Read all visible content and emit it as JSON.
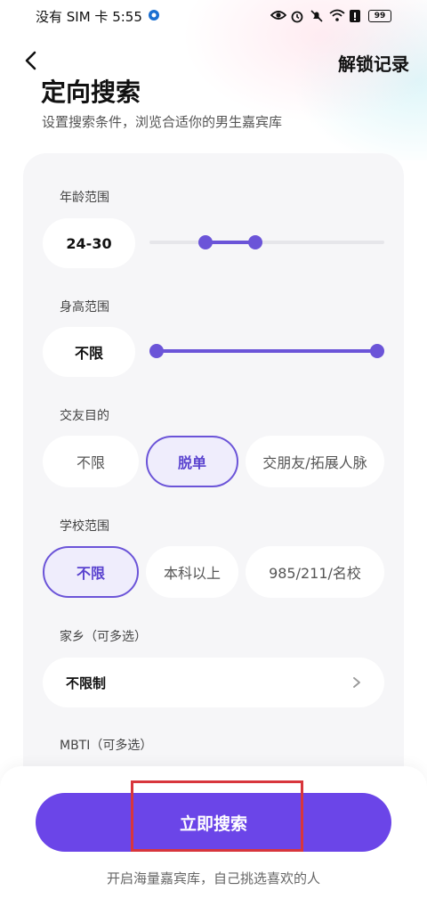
{
  "status_bar": {
    "carrier_time": "没有 SIM 卡 5:55",
    "battery": "99",
    "icons": [
      "eye-icon",
      "alarm-icon",
      "mute-icon",
      "wifi-icon",
      "alert-icon",
      "battery-icon"
    ]
  },
  "header": {
    "unlock_records": "解锁记录",
    "title": "定向搜索",
    "subtitle": "设置搜索条件，浏览合适你的男生嘉宾库"
  },
  "filters": {
    "age": {
      "label": "年龄范围",
      "value": "24-30",
      "range_fraction": [
        0.24,
        0.45
      ]
    },
    "height": {
      "label": "身高范围",
      "value": "不限",
      "range_fraction": [
        0.0,
        1.0
      ]
    },
    "purpose": {
      "label": "交友目的",
      "options": [
        "不限",
        "脱单",
        "交朋友/拓展人脉"
      ],
      "selected": "脱单"
    },
    "school": {
      "label": "学校范围",
      "options": [
        "不限",
        "本科以上",
        "985/211/名校"
      ],
      "selected": "不限"
    },
    "hometown": {
      "label": "家乡（可多选）",
      "value": "不限制"
    },
    "mbti": {
      "label": "MBTI（可多选）"
    }
  },
  "actions": {
    "search_button": "立即搜索",
    "footer_note": "开启海量嘉宾库，自己挑选喜欢的人"
  },
  "colors": {
    "accent": "#6b45e8",
    "selected_border": "#6b54d8",
    "highlight": "#d8363c"
  }
}
